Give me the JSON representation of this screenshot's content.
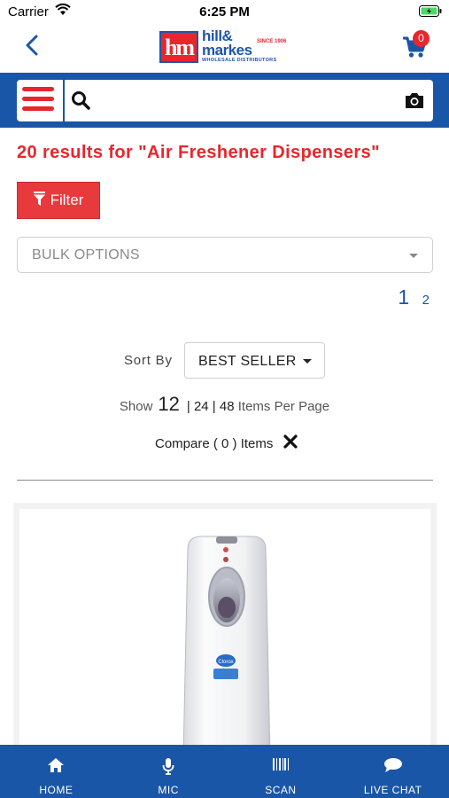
{
  "status_bar": {
    "carrier": "Carrier",
    "time": "6:25 PM"
  },
  "header": {
    "logo": {
      "mark": "hm",
      "line1": "hill&",
      "line2": "markes",
      "since": "SINCE 1906",
      "tagline": "WHOLESALE DISTRIBUTORS"
    },
    "cart_count": "0"
  },
  "search": {
    "placeholder": ""
  },
  "results": {
    "title": "20 results for \"Air Freshener Dispensers\""
  },
  "filter": {
    "label": "Filter"
  },
  "bulk_options": {
    "label": "BULK OPTIONS"
  },
  "pagination": {
    "current": "1",
    "next": "2"
  },
  "sort": {
    "label": "Sort By",
    "value": "BEST SELLER"
  },
  "per_page": {
    "show_label": "Show",
    "current": "12",
    "opt1": "| 24 |",
    "opt2": "48",
    "suffix": "Items Per Page"
  },
  "compare": {
    "label": "Compare ( 0 ) Items"
  },
  "product": {
    "brand_text": "Clorox"
  },
  "bottom_nav": [
    {
      "label": "HOME",
      "icon": "home-icon"
    },
    {
      "label": "MIC",
      "icon": "mic-icon"
    },
    {
      "label": "SCAN",
      "icon": "barcode-icon"
    },
    {
      "label": "LIVE CHAT",
      "icon": "chat-icon"
    }
  ],
  "colors": {
    "brand_blue": "#1a56a8",
    "brand_red": "#e8262d"
  }
}
